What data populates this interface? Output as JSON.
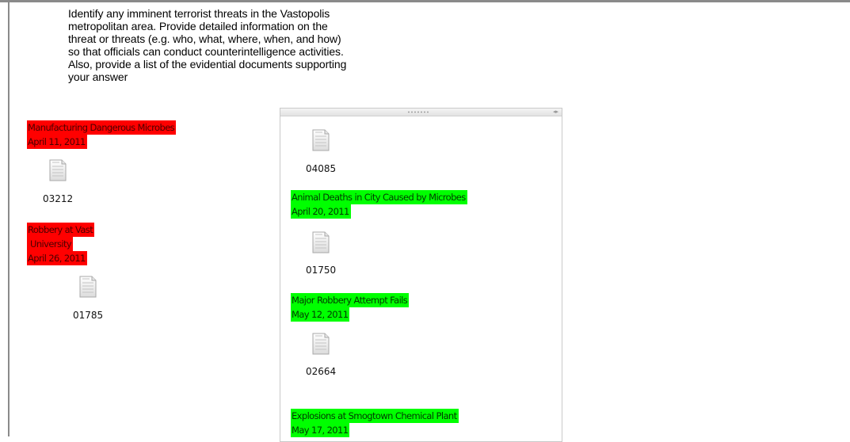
{
  "task": {
    "lines": [
      "Identify any imminent terrorist threats in the Vastopolis",
      "metropolitan area. Provide detailed information on the",
      "threat or threats (e.g. who, what, where, when, and how)",
      "so that officials can conduct counterintelligence activities.",
      "Also, provide a list of the evidential documents supporting",
      "your answer"
    ]
  },
  "left_notes": [
    {
      "lines": [
        "Manufacturing Dangerous Microbes",
        "April 11, 2011"
      ],
      "doc": "03212",
      "color": "#ff0000"
    },
    {
      "lines": [
        "Robbery at Vast",
        " University",
        "April 26, 2011"
      ],
      "doc": "01785",
      "color": "#ff0000"
    }
  ],
  "panel": {
    "top_doc": "04085",
    "notes": [
      {
        "lines": [
          "Animal Deaths in City Caused by Microbes",
          "April 20, 2011"
        ],
        "doc": "01750",
        "color": "#00ff00"
      },
      {
        "lines": [
          "Major Robbery Attempt Fails",
          "May 12, 2011"
        ],
        "doc": "02664",
        "color": "#00ff00"
      },
      {
        "lines": [
          "Explosions at Smogtown Chemical Plant",
          "May 17, 2011"
        ],
        "color": "#00ff00"
      }
    ]
  },
  "icons": {
    "document": "document-icon",
    "resize": "resize-arrows-icon",
    "grip": "grip-icon"
  }
}
